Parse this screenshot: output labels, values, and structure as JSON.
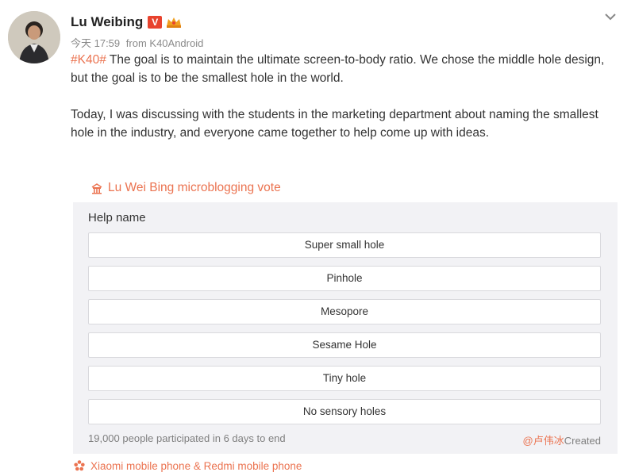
{
  "author": {
    "name": "Lu Weibing",
    "verified_badge": "V",
    "time": "今天 17:59",
    "source_device": "from K40Android"
  },
  "post": {
    "hashtag": "#K40#",
    "paragraph1_rest": " The goal is to maintain the ultimate screen-to-body ratio. We chose the middle hole design, but the goal is to be the smallest hole in the world.",
    "paragraph2": "Today, I was discussing with the students in the marketing department about naming the smallest hole in the industry, and everyone came together to help come up with ideas."
  },
  "vote": {
    "link_label": "Lu Wei Bing microblogging vote",
    "title": "Help name",
    "options": [
      "Super small hole",
      "Pinhole",
      "Mesopore",
      "Sesame Hole",
      "Tiny hole",
      "No sensory holes"
    ],
    "participation": "19,000 people participated in 6 days to end",
    "creator_mention": "@卢伟冰",
    "creator_suffix": "Created"
  },
  "footer": {
    "source_label": "Xiaomi mobile phone & Redmi mobile phone"
  },
  "colors": {
    "accent": "#eb7350",
    "verified": "#e8432e",
    "card_bg": "#f2f2f5"
  },
  "icons": {
    "more": "chevron-down-icon",
    "vote": "vote-icon",
    "source": "flower-icon",
    "crown": "crown-icon"
  }
}
